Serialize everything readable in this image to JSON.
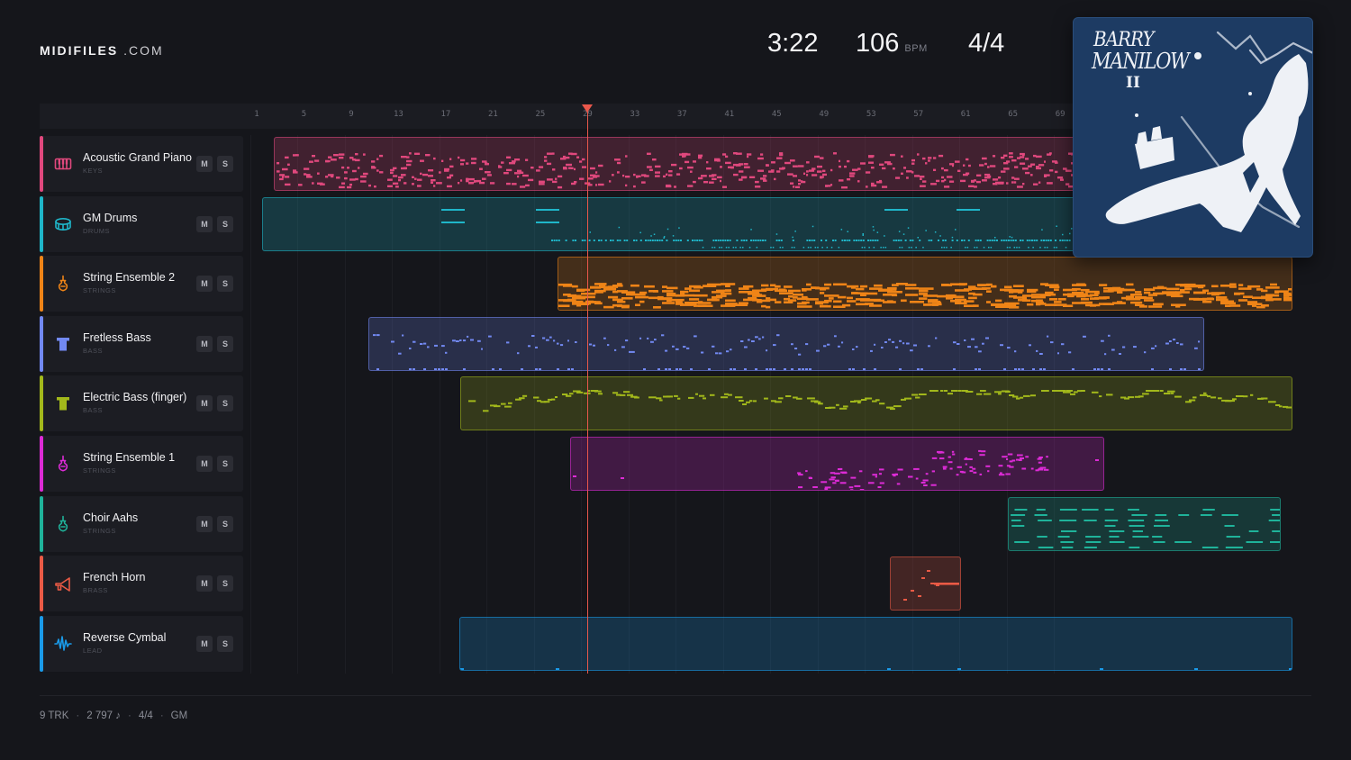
{
  "brand": {
    "name": "MIDIFILES",
    "tld": ".COM"
  },
  "transport": {
    "time": "3:22",
    "tempo": "106",
    "tempo_unit": "BPM",
    "meter": "4/4"
  },
  "ruler": {
    "ticks": [
      "1",
      "5",
      "9",
      "13",
      "17",
      "21",
      "25",
      "29",
      "33",
      "37",
      "41",
      "45",
      "49",
      "53",
      "57",
      "61",
      "65",
      "69"
    ]
  },
  "playhead": {
    "bar": 29
  },
  "tracks": [
    {
      "name": "Acoustic Grand Piano",
      "category": "KEYS",
      "color": "#e0487d",
      "icon": "piano-icon",
      "mute": "M",
      "solo": "S"
    },
    {
      "name": "GM Drums",
      "category": "DRUMS",
      "color": "#1fb6c9",
      "icon": "drum-icon",
      "mute": "M",
      "solo": "S"
    },
    {
      "name": "String Ensemble 2",
      "category": "STRINGS",
      "color": "#ef8417",
      "icon": "violin-icon",
      "mute": "M",
      "solo": "S"
    },
    {
      "name": "Fretless Bass",
      "category": "BASS",
      "color": "#7289f2",
      "icon": "bass-icon",
      "mute": "M",
      "solo": "S"
    },
    {
      "name": "Electric Bass (finger)",
      "category": "BASS",
      "color": "#a2b81b",
      "icon": "bass-icon",
      "mute": "M",
      "solo": "S"
    },
    {
      "name": "String Ensemble 1",
      "category": "STRINGS",
      "color": "#dd2bd6",
      "icon": "violin-icon",
      "mute": "M",
      "solo": "S"
    },
    {
      "name": "Choir Aahs",
      "category": "STRINGS",
      "color": "#1fb39a",
      "icon": "violin-icon",
      "mute": "M",
      "solo": "S"
    },
    {
      "name": "French Horn",
      "category": "BRASS",
      "color": "#ea5a45",
      "icon": "horn-icon",
      "mute": "M",
      "solo": "S"
    },
    {
      "name": "Reverse Cymbal",
      "category": "LEAD",
      "color": "#1a9ae8",
      "icon": "waveform-icon",
      "mute": "M",
      "solo": "S"
    }
  ],
  "album": {
    "artist_line1": "BARRY",
    "artist_line2": "MANILOW",
    "volume": "II"
  },
  "footer": {
    "tracks": "9 TRK",
    "notes": "2 797 ♪",
    "meter": "4/4",
    "standard": "GM"
  }
}
